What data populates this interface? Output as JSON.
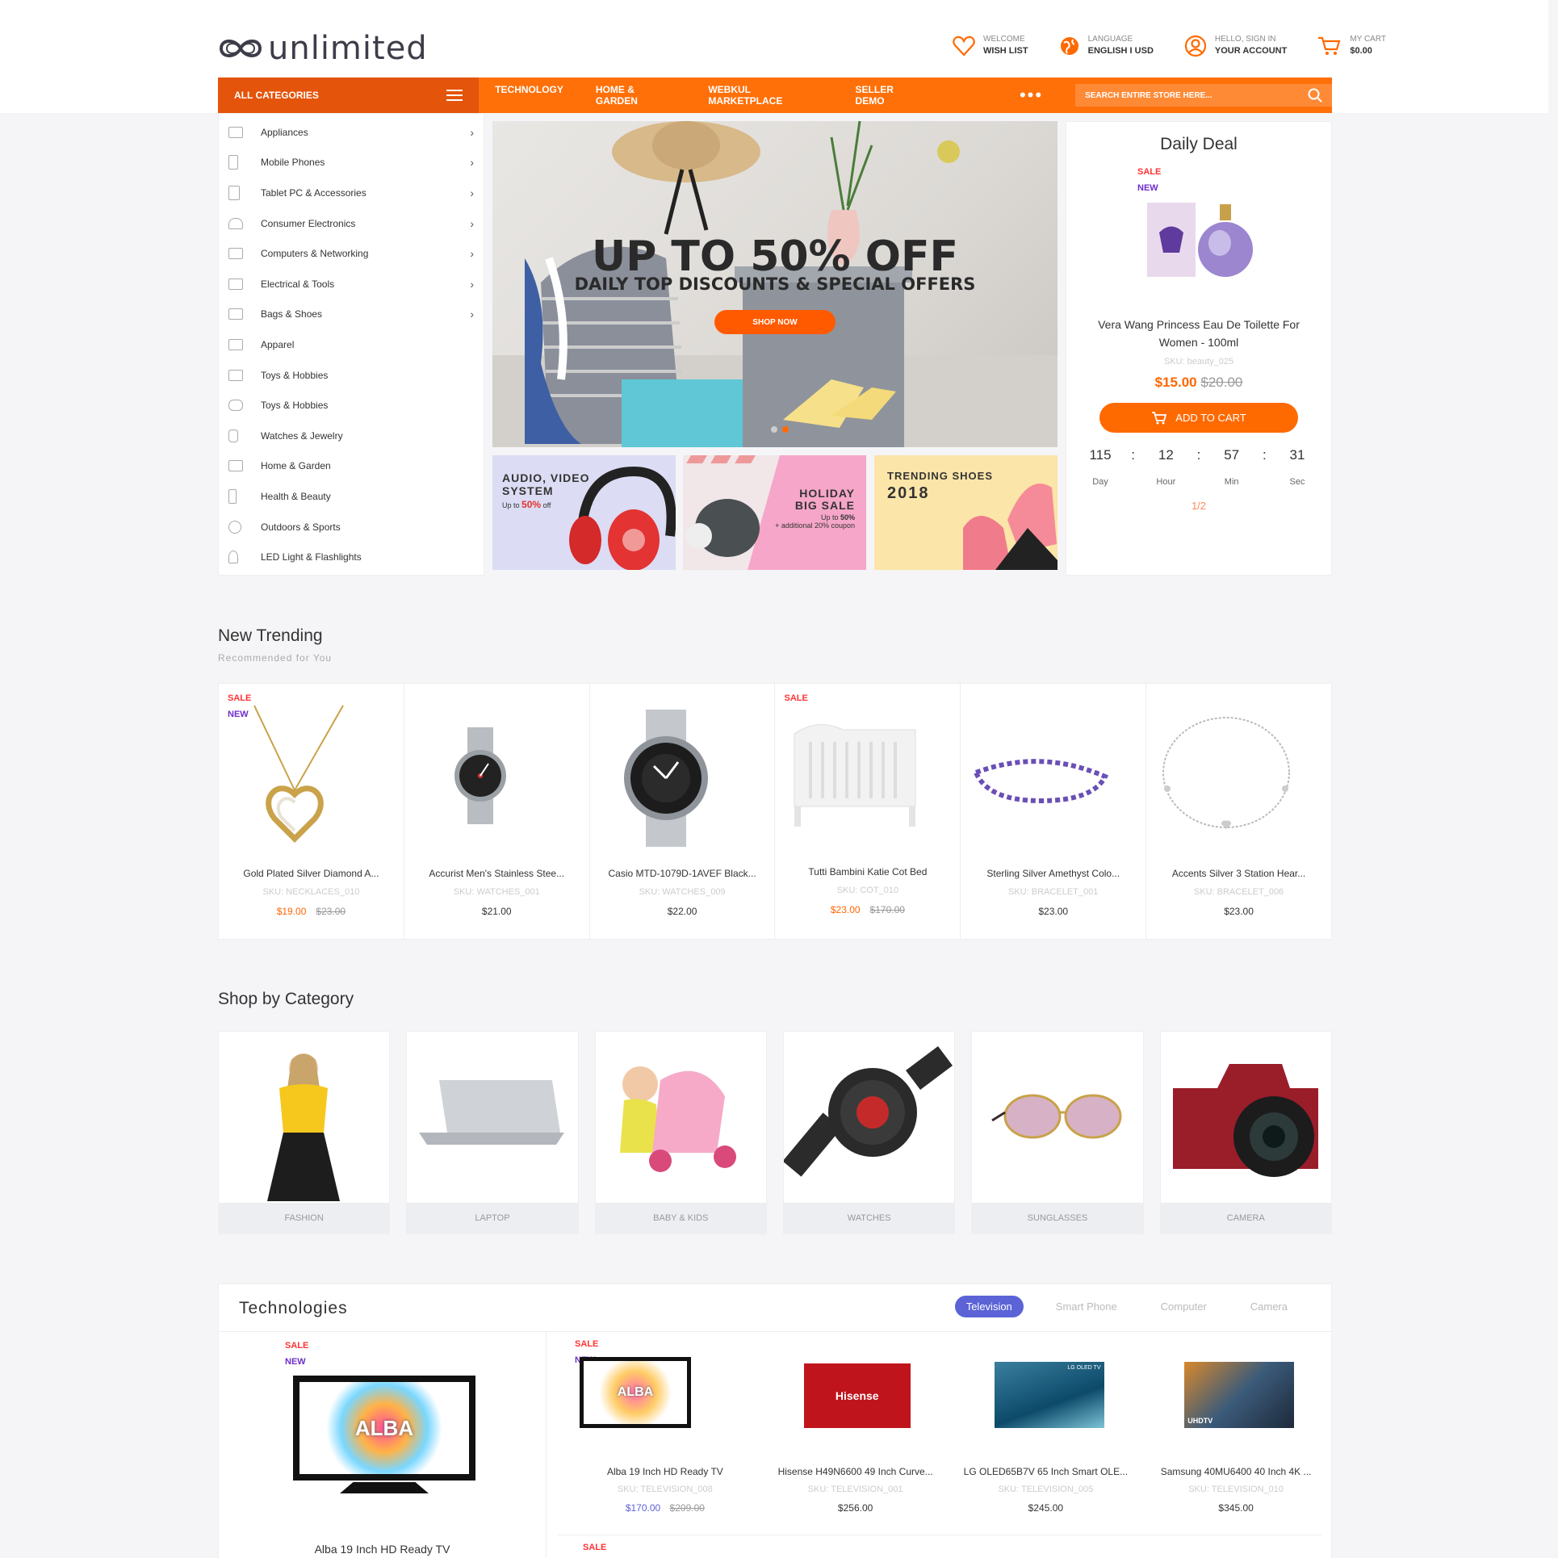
{
  "header": {
    "logo": "unlimited",
    "links": [
      {
        "l1": "WELCOME",
        "l2": "WISH LIST"
      },
      {
        "l1": "LANGUAGE",
        "l2": "ENGLISH I USD"
      },
      {
        "l1": "HELLO, SIGN IN",
        "l2": "YOUR ACCOUNT"
      },
      {
        "l1": "MY CART",
        "l2": "$0.00"
      }
    ]
  },
  "nav": {
    "all_categories": "ALL CATEGORIES",
    "menu": [
      "TECHNOLOGY",
      "HOME & GARDEN",
      "WEBKUL MARKETPLACE",
      "SELLER DEMO"
    ],
    "more": "•••",
    "search_placeholder": "SEARCH ENTIRE STORE HERE..."
  },
  "sidebar": [
    "Appliances",
    "Mobile Phones",
    "Tablet PC & Accessories",
    "Consumer Electronics",
    "Computers & Networking",
    "Electrical & Tools",
    "Bags & Shoes",
    "Apparel",
    "Toys & Hobbies",
    "Toys & Hobbies",
    "Watches & Jewelry",
    "Home & Garden",
    "Health & Beauty",
    "Outdoors & Sports",
    "LED Light & Flashlights"
  ],
  "hero": {
    "title": "UP TO 50% OFF",
    "subtitle": "DAILY TOP DISCOUNTS & SPECIAL OFFERS",
    "button": "SHOP NOW"
  },
  "banners": {
    "b1": {
      "t1": "AUDIO, VIDEO",
      "t2": "SYSTEM",
      "t3": "Up to",
      "t4": "50%",
      "t5": "off"
    },
    "b2": {
      "t1": "HOLIDAY",
      "t2": "BIG SALE",
      "t3": "Up to",
      "t4": "50%",
      "t5": "+ additional 20% coupon"
    },
    "b3": {
      "t1": "TRENDING SHOES",
      "t2": "2018"
    }
  },
  "deal": {
    "title": "Daily Deal",
    "sale": "SALE",
    "new": "NEW",
    "name": "Vera Wang Princess Eau De Toilette For Women - 100ml",
    "sku": "SKU: beauty_025",
    "price": "$15.00",
    "old_price": "$20.00",
    "button": "ADD TO CART",
    "countdown": [
      {
        "v": "115",
        "l": "Day"
      },
      {
        "v": "12",
        "l": "Hour"
      },
      {
        "v": "57",
        "l": "Min"
      },
      {
        "v": "31",
        "l": "Sec"
      }
    ],
    "pager": "1/2",
    "sep": ":"
  },
  "trending": {
    "title": "New Trending",
    "subtitle": "Recommended for You",
    "items": [
      {
        "name": "Gold Plated Silver Diamond A...",
        "sku": "SKU: NECKLACES_010",
        "price": "$19.00",
        "old": "$23.00",
        "sale": "SALE",
        "new": "NEW"
      },
      {
        "name": "Accurist Men's Stainless Stee...",
        "sku": "SKU: WATCHES_001",
        "price": "$21.00"
      },
      {
        "name": "Casio MTD-1079D-1AVEF Black...",
        "sku": "SKU: WATCHES_009",
        "price": "$22.00"
      },
      {
        "name": "Tutti Bambini Katie Cot Bed",
        "sku": "SKU: COT_010",
        "price": "$23.00",
        "old": "$170.00",
        "sale": "SALE"
      },
      {
        "name": "Sterling Silver Amethyst Colo...",
        "sku": "SKU: BRACELET_001",
        "price": "$23.00"
      },
      {
        "name": "Accents Silver 3 Station Hear...",
        "sku": "SKU: BRACELET_006",
        "price": "$23.00"
      }
    ]
  },
  "categories": {
    "title": "Shop by Category",
    "items": [
      "FASHION",
      "LAPTOP",
      "BABY & KIDS",
      "WATCHES",
      "SUNGLASSES",
      "CAMERA"
    ]
  },
  "tech": {
    "title": "Technologies",
    "tabs": [
      "Television",
      "Smart Phone",
      "Computer",
      "Camera"
    ],
    "featured": {
      "sale": "SALE",
      "new": "NEW",
      "name": "Alba 19 Inch HD Ready TV",
      "brand": "ALBA"
    },
    "items": [
      {
        "name": "Alba 19 Inch HD Ready TV",
        "sku": "SKU: TELEVISION_008",
        "price": "$170.00",
        "old": "$209.00",
        "sale": "SALE",
        "new": "NEW",
        "brand": "ALBA"
      },
      {
        "name": "Hisense H49N6600 49 Inch Curve...",
        "sku": "SKU: TELEVISION_001",
        "price": "$256.00",
        "brand": "Hisense"
      },
      {
        "name": "LG OLED65B7V 65 Inch Smart OLE...",
        "sku": "SKU: TELEVISION_005",
        "price": "$245.00",
        "brand": "LG OLED TV"
      },
      {
        "name": "Samsung 40MU6400 40 Inch 4K ...",
        "sku": "SKU: TELEVISION_010",
        "price": "$345.00",
        "brand": "UHDTV"
      }
    ],
    "next_sale": "SALE"
  },
  "colors": {
    "accent": "#ff7009",
    "accent_dark": "#e4540b",
    "sale": "#ff3333",
    "new": "#6f2dcc",
    "tab": "#5b63d6"
  }
}
